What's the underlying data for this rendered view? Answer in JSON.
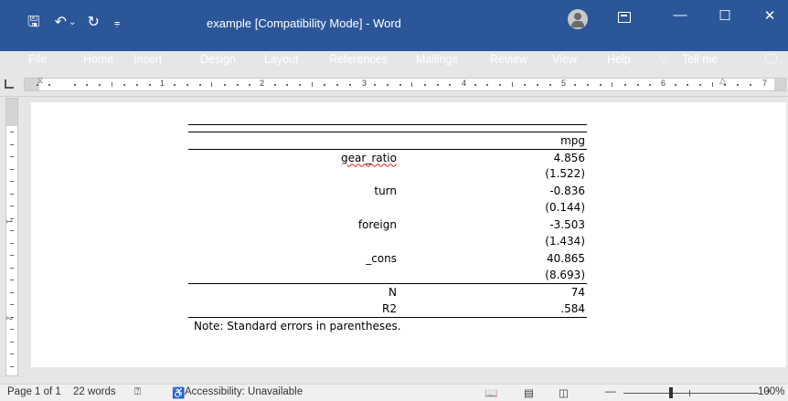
{
  "titlebar": {
    "save_icon": "🖫",
    "undo_icon": "↶",
    "undo_dropdown_icon": "⌄",
    "redo_icon": "↻",
    "customize_icon": "⩦",
    "title": "example [Compatibility Mode]  -  Word",
    "minimize_icon": "—",
    "maximize_icon": "☐",
    "close_icon": "✕"
  },
  "menu": {
    "items": [
      "File",
      "Home",
      "Insert",
      "Design",
      "Layout",
      "References",
      "Mailings",
      "Review",
      "View",
      "Help",
      "Tell me"
    ],
    "lightbulb_icon": "♡",
    "comment_icon": "🗨"
  },
  "ruler": {
    "numbers": [
      "1",
      "2",
      "3",
      "4",
      "5",
      "6",
      "7"
    ]
  },
  "vruler": {
    "numbers": [
      "1",
      "2"
    ]
  },
  "table": {
    "header": "mpg",
    "rows": [
      {
        "label": "gear_ratio",
        "value": "4.856",
        "se": "(1.522)"
      },
      {
        "label": "turn",
        "value": "-0.836",
        "se": "(0.144)"
      },
      {
        "label": "foreign",
        "value": "-3.503",
        "se": "(1.434)"
      },
      {
        "label": "_cons",
        "value": "40.865",
        "se": "(8.693)"
      }
    ],
    "stats": [
      {
        "label": "N",
        "value": "74"
      },
      {
        "label": "R2",
        "value": ".584"
      }
    ],
    "note": "Note: Standard errors in parentheses."
  },
  "status": {
    "page": "Page 1 of 1",
    "words": "22 words",
    "proofing_icon": "⍰",
    "accessibility": "Accessibility: Unavailable",
    "accessibility_icon": "♿",
    "read_mode_icon": "📖",
    "print_layout_icon": "▤",
    "web_layout_icon": "◫",
    "zoom_minus": "—",
    "zoom_plus": "+",
    "zoom": "100%",
    "zoom_level_percent": 100
  }
}
